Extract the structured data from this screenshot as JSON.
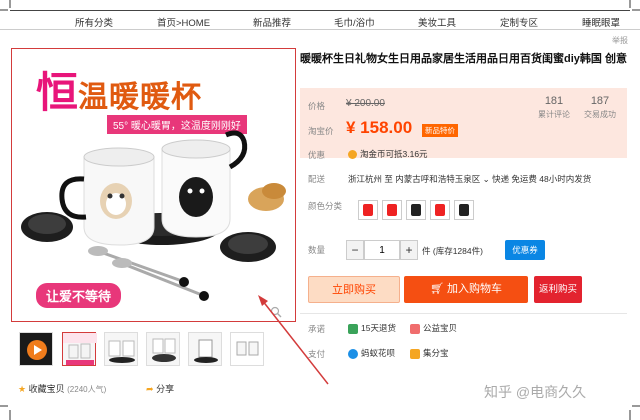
{
  "nav": {
    "items": [
      "所有分类",
      "首页>HOME",
      "新品推荐",
      "毛巾/浴巾",
      "美妆工具",
      "定制专区",
      "睡眠眼罩"
    ]
  },
  "hero": {
    "title_first": "恒",
    "title_rest": "温暖暖杯",
    "subtitle": "55° 暖心暖胃，这温度刚刚好",
    "bottom_banner": "让爱不等待"
  },
  "product": {
    "title": "暖暖杯生日礼物女生日用品家居生活用品日用百货闺蜜diy韩国 创意",
    "report": "举报",
    "price_label": "价格",
    "original_price": "¥ 200.00",
    "promo_label": "淘宝价",
    "sale_price": "¥ 158.00",
    "sale_badge": "新品特价",
    "stats": [
      {
        "num": "181",
        "label": "累计评论"
      },
      {
        "num": "187",
        "label": "交易成功"
      }
    ],
    "coupon_label": "优惠",
    "coupon_text": "淘金币可抵3.16元",
    "shipping_label": "配送",
    "shipping_text": "浙江杭州 至  内蒙古呼和浩特玉泉区 ⌄   快递 免运费   48小时内发货",
    "color_label": "颜色分类",
    "qty_label": "数量",
    "qty_value": "1",
    "stock_text": "件 (库存1284件)",
    "coupon_btn": "优惠券",
    "buy_now": "立即购买",
    "add_cart": "加入购物车",
    "rebate": "返利购买",
    "promise_label": "承诺",
    "promise_1": "15天退货",
    "promise_2": "公益宝贝",
    "pay_label": "支付",
    "pay_1": "蚂蚁花呗",
    "pay_2": "集分宝"
  },
  "gallery": {
    "favorite_label": "收藏宝贝",
    "favorite_count": "(2240人气)",
    "share_label": "分享"
  },
  "watermark": "知乎 @电商久久",
  "colors": {
    "accent": "#f40",
    "cart": "#f54f12",
    "rebate": "#e3232f",
    "price_bg": "#fde7df",
    "hero_pink": "#e8157a",
    "hero_orange": "#e05a10",
    "annotation": "#d33b3b"
  }
}
